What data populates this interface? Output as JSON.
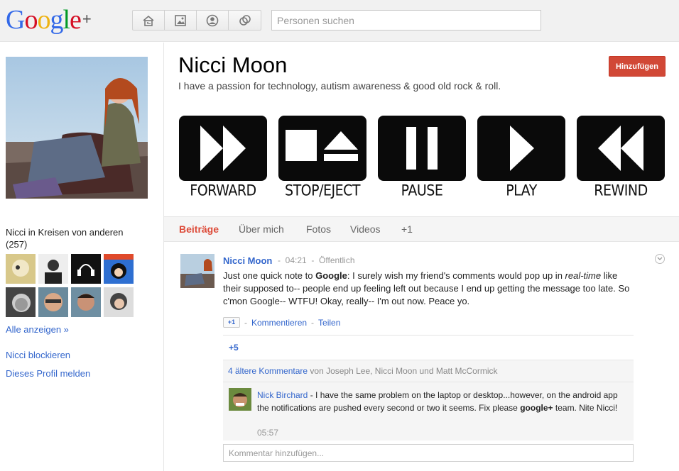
{
  "header": {
    "logo_text": "Google",
    "logo_plus": "+",
    "logo_colors": [
      "#3369e8",
      "#d50f25",
      "#eeb211",
      "#3369e8",
      "#009925",
      "#d50f25"
    ],
    "nav_icons": [
      "home-icon",
      "photos-icon",
      "profile-icon",
      "circles-icon"
    ],
    "search_placeholder": "Personen suchen"
  },
  "sidebar": {
    "circles_heading": "Nicci in Kreisen von anderen",
    "circles_count": "(257)",
    "show_all": "Alle anzeigen »",
    "block": "Nicci blockieren",
    "report": "Dieses Profil melden",
    "thumbs": [
      "avatar-1",
      "avatar-2",
      "avatar-3",
      "avatar-4",
      "avatar-5",
      "avatar-6",
      "avatar-7",
      "avatar-8"
    ]
  },
  "profile": {
    "name": "Nicci Moon",
    "tagline": "I have a passion for technology, autism awareness & good old rock & roll.",
    "add_button": "Hinzufügen",
    "accent_color": "#dd4b39"
  },
  "banner": {
    "labels": [
      "FORWARD",
      "STOP/EJECT",
      "PAUSE",
      "PLAY",
      "REWIND"
    ]
  },
  "tabs": [
    {
      "label": "Beiträge",
      "active": true
    },
    {
      "label": "Über mich",
      "active": false
    },
    {
      "label": "Fotos",
      "active": false
    },
    {
      "label": "Videos",
      "active": false
    },
    {
      "label": "+1",
      "active": false
    }
  ],
  "post": {
    "author": "Nicci Moon",
    "sep": "-",
    "time": "04:21",
    "visibility": "Öffentlich",
    "body_1": "Just one quick note to ",
    "body_bold": "Google",
    "body_2": ": I surely wish my friend's comments would pop up in ",
    "body_italic": "real-time",
    "body_3": " like their supposed to-- people end up feeling left out because I end up getting the message too late. So c'mon Google-- WTFU! Okay, really-- I'm out now. Peace yo.",
    "plusone_label": "+1",
    "comment_action": "Kommentieren",
    "share_action": "Teilen",
    "plus_count": "+5",
    "older_comments_link": "4 ältere Kommentare",
    "older_comments_rest": " von Joseph Lee, Nicci Moon und Matt McCormick"
  },
  "comment": {
    "author": "Nick Birchard",
    "text_1": " - I have the same problem on the laptop or desktop...however, on the android app the notifications are pushed every second or two it seems. Fix please ",
    "text_bold": "google+",
    "text_2": " team. Nite Nicci!",
    "time": "05:57",
    "input_placeholder": "Kommentar hinzufügen..."
  }
}
